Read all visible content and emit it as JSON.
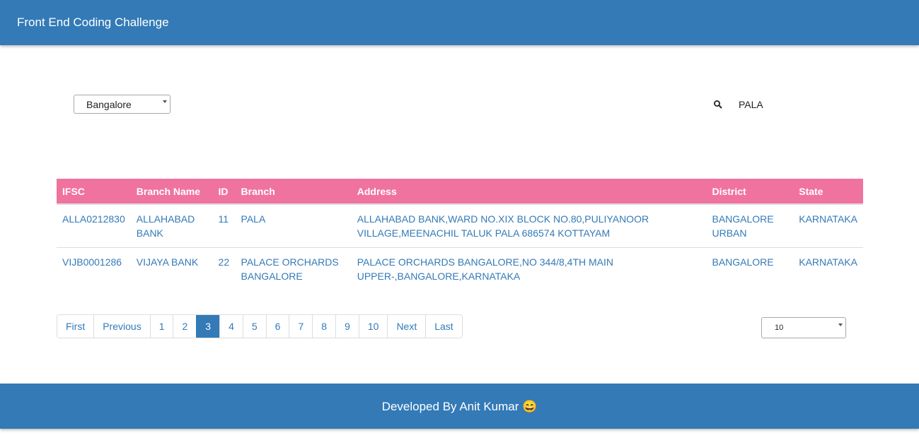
{
  "app": {
    "title": "Front End Coding Challenge"
  },
  "filters": {
    "city": "Bangalore",
    "search_value": "PALA",
    "search_icon": "search-icon"
  },
  "table": {
    "columns": [
      "IFSC",
      "Branch Name",
      "ID",
      "Branch",
      "Address",
      "District",
      "State"
    ],
    "rows": [
      {
        "ifsc": "ALLA0212830",
        "bank_name": "ALLAHABAD BANK",
        "id": "11",
        "branch": "PALA",
        "address": "ALLAHABAD BANK,WARD NO.XIX BLOCK NO.80,PULIYANOOR VILLAGE,MEENACHIL TALUK PALA 686574 KOTTAYAM",
        "district": "BANGALORE URBAN",
        "state": "KARNATAKA"
      },
      {
        "ifsc": "VIJB0001286",
        "bank_name": "VIJAYA BANK",
        "id": "22",
        "branch": "PALACE ORCHARDS BANGALORE",
        "address": "PALACE ORCHARDS BANGALORE,NO 344/8,4TH MAIN UPPER-,BANGALORE,KARNATAKA",
        "district": "BANGALORE",
        "state": "KARNATAKA"
      }
    ]
  },
  "pagination": {
    "first": "First",
    "previous": "Previous",
    "pages": [
      "1",
      "2",
      "3",
      "4",
      "5",
      "6",
      "7",
      "8",
      "9",
      "10"
    ],
    "current_page": "3",
    "next": "Next",
    "last": "Last",
    "page_size": "10"
  },
  "footer": {
    "credit": "Developed By Anit Kumar 😄"
  },
  "colors": {
    "primary": "#337ab7",
    "table_header": "#f0739f",
    "link": "#337ab7"
  }
}
